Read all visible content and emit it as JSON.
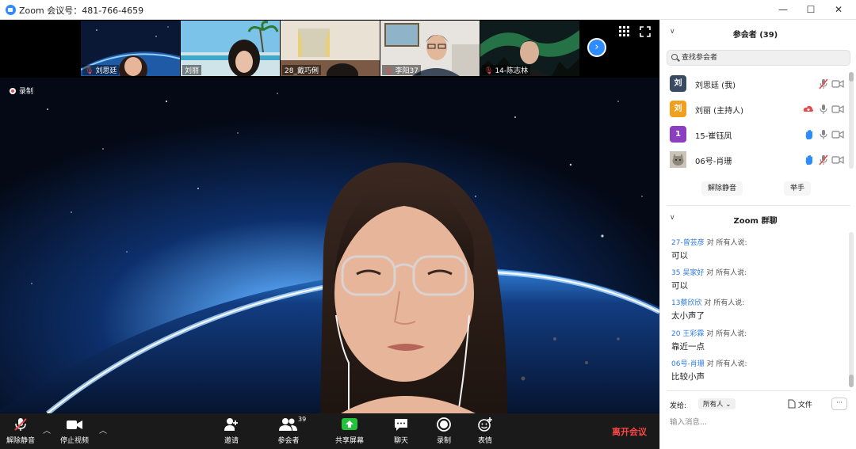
{
  "window": {
    "title": "Zoom 会议号：481-766-4659",
    "minimize": "—",
    "maximize": "☐",
    "close": "✕"
  },
  "thumbnails": [
    {
      "name": "刘思廷",
      "muted": true
    },
    {
      "name": "刘丽",
      "muted": false
    },
    {
      "name": "28_戴巧俐",
      "muted": false
    },
    {
      "name": "李阳37",
      "muted": true
    },
    {
      "name": "14-陈志林",
      "muted": true
    }
  ],
  "recording": {
    "label": "录制"
  },
  "toolbar": {
    "unmute": "解除静音",
    "stop_video": "停止视频",
    "invite": "邀请",
    "participants": "参会者",
    "participants_count": "39",
    "share": "共享屏幕",
    "chat": "聊天",
    "record": "录制",
    "reactions": "表情",
    "leave": "离开会议"
  },
  "participants_panel": {
    "title": "参会者 (39)",
    "search_placeholder": "查找参会者",
    "items": [
      {
        "initial": "刘",
        "name": "刘思廷 (我)",
        "color": "#3a4a63"
      },
      {
        "initial": "刘",
        "name": "刘丽 (主持人)",
        "color": "#f0a01e"
      },
      {
        "initial": "1",
        "name": "15-崔钰凤",
        "color": "#8b3fbf"
      },
      {
        "initial": "",
        "name": "06号-肖珊",
        "color": "#b9b2a8"
      }
    ],
    "unmute_button": "解除静音",
    "raise_hand_button": "举手"
  },
  "chat_panel": {
    "title": "Zoom 群聊",
    "messages": [
      {
        "from": "27-曾芸彦",
        "to": "对 所有人说:",
        "text": "可以"
      },
      {
        "from": "35 吴家好",
        "to": "对 所有人说:",
        "text": "可以"
      },
      {
        "from": "13蔡欣欣",
        "to": "对 所有人说:",
        "text": "太小声了"
      },
      {
        "from": "20 王彩霖",
        "to": "对 所有人说:",
        "text": "靠近一点"
      },
      {
        "from": "06号-肖珊",
        "to": "对 所有人说:",
        "text": "比较小声"
      }
    ],
    "send_to_label": "发给:",
    "send_to_value": "所有人",
    "file_label": "文件",
    "more": "···",
    "input_placeholder": "输入消息..."
  },
  "colors": {
    "accent": "#2d8cff",
    "muted_red": "#e84b4b",
    "leave_red": "#ff4747",
    "toolbar_bg": "#1a1a1a"
  }
}
